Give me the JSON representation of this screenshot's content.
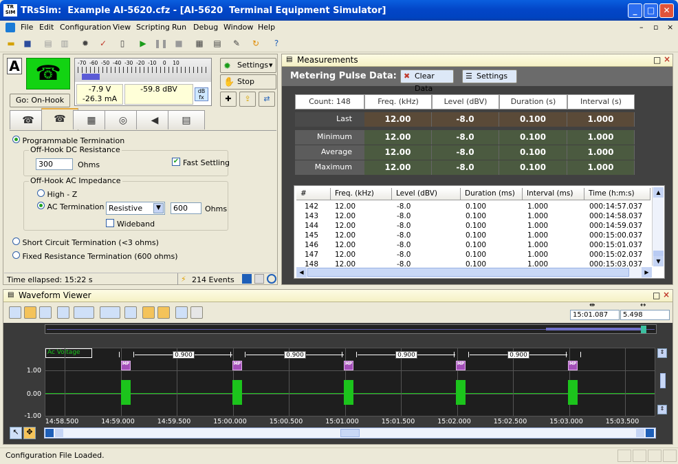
{
  "window": {
    "logo": "TR SIM",
    "title": "TRsSim:  Example AI-5620.cfz - [AI-5620  Terminal Equipment Simulator]",
    "buttons": [
      "_",
      "□",
      "✕"
    ]
  },
  "menu": [
    "File",
    "Edit",
    "Configuration",
    "View",
    "Scripting",
    "Run",
    "Debug",
    "Window",
    "Help"
  ],
  "mdi_controls": [
    "–",
    "▫",
    "×"
  ],
  "left": {
    "line_letter": "A",
    "goto_button": "Go:  On-Hook",
    "meter": {
      "scale": "-70  -60  -50  -40  -30  -20  -10    0    10",
      "voltage": "-7.9  V",
      "current": "-26.3 mA",
      "level": "-59.8 dBV"
    },
    "settings_button": "Settings",
    "stop_button": "Stop",
    "programmable_termination": "Programmable Termination",
    "dc_group": "Off-Hook DC Resistance",
    "dc_value": "300",
    "dc_unit": "Ohms",
    "fast_settling": "Fast Settling",
    "ac_group": "Off-Hook AC Impedance",
    "high_z": "High - Z",
    "ac_termination": "AC Termination",
    "ac_mode": "Resistive",
    "ac_value": "600",
    "ac_unit": "Ohms",
    "wideband": "Wideband",
    "short_circuit": "Short Circuit Termination (<3 ohms)",
    "fixed_resistance": "Fixed Resistance Termination (600 ohms)",
    "time_elapsed": "Time ellapsed:  15:22 s",
    "events": "214 Events"
  },
  "measurements": {
    "title": "Measurements",
    "subtitle": "Metering Pulse Data:",
    "clear_button": "Clear Data",
    "settings_button": "Settings",
    "count": "Count:  148",
    "headers": [
      "Freq. (kHz)",
      "Level (dBV)",
      "Duration (s)",
      "Interval (s)"
    ],
    "rows": [
      {
        "label": "Last",
        "values": [
          "12.00",
          "-8.0",
          "0.100",
          "1.000"
        ]
      },
      {
        "label": "Minimum",
        "values": [
          "12.00",
          "-8.0",
          "0.100",
          "1.000"
        ]
      },
      {
        "label": "Average",
        "values": [
          "12.00",
          "-8.0",
          "0.100",
          "1.000"
        ]
      },
      {
        "label": "Maximum",
        "values": [
          "12.00",
          "-8.0",
          "0.100",
          "1.000"
        ]
      }
    ],
    "table_headers": [
      "#",
      "Freq. (kHz)",
      "Level (dBV)",
      "Duration (ms)",
      "Interval (ms)",
      "Time (h:m:s)"
    ],
    "table_rows": [
      [
        "142",
        "12.00",
        "-8.0",
        "0.100",
        "1.000",
        "000:14:57.037"
      ],
      [
        "143",
        "12.00",
        "-8.0",
        "0.100",
        "1.000",
        "000:14:58.037"
      ],
      [
        "144",
        "12.00",
        "-8.0",
        "0.100",
        "1.000",
        "000:14:59.037"
      ],
      [
        "145",
        "12.00",
        "-8.0",
        "0.100",
        "1.000",
        "000:15:00.037"
      ],
      [
        "146",
        "12.00",
        "-8.0",
        "0.100",
        "1.000",
        "000:15:01.037"
      ],
      [
        "147",
        "12.00",
        "-8.0",
        "0.100",
        "1.000",
        "000:15:02.037"
      ],
      [
        "148",
        "12.00",
        "-8.0",
        "0.100",
        "1.000",
        "000:15:03.037"
      ]
    ]
  },
  "waveform": {
    "title": "Waveform Viewer",
    "time_box": "15:01.087",
    "span_box": "5.498",
    "channel_label": "Ac Voltage",
    "y_ticks": [
      "1.00",
      "0.00",
      "-1.00"
    ],
    "x_ticks": [
      "14:58.500",
      "14:59.000",
      "14:59.500",
      "15:00.000",
      "15:00.500",
      "15:01.000",
      "15:01.500",
      "15:02.000",
      "15:02.500",
      "15:03.000",
      "15:03.500"
    ],
    "interval_label": "0.900",
    "mp_label": "MP"
  },
  "status": "Configuration File Loaded.",
  "colors": {
    "accent_green": "#1cc41c",
    "title_blue": "#0346c8"
  }
}
